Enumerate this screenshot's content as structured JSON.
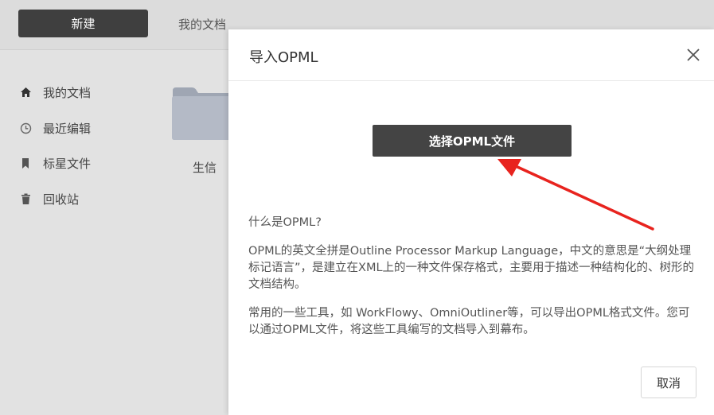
{
  "topbar": {
    "new_label": "新建",
    "my_docs_tab": "我的文档"
  },
  "sidebar": {
    "items": [
      {
        "label": "我的文档",
        "icon": "home-icon"
      },
      {
        "label": "最近编辑",
        "icon": "clock-icon"
      },
      {
        "label": "标星文件",
        "icon": "bookmark-icon"
      },
      {
        "label": "回收站",
        "icon": "trash-icon"
      }
    ]
  },
  "main": {
    "folder_label": "生信"
  },
  "dialog": {
    "title": "导入OPML",
    "choose_button": "选择OPML文件",
    "info_heading": "什么是OPML?",
    "paragraph1": "OPML的英文全拼是Outline Processor Markup Language，中文的意思是“大纲处理标记语言”，是建立在XML上的一种文件保存格式，主要用于描述一种结构化的、树形的文档结构。",
    "paragraph2": "常用的一些工具，如 WorkFlowy、OmniOutliner等，可以导出OPML格式文件。您可以通过OPML文件，将这些工具编写的文档导入到幕布。",
    "cancel_button": "取消"
  },
  "colors": {
    "primary_button": "#444444",
    "annotation_arrow": "#e8231e"
  }
}
